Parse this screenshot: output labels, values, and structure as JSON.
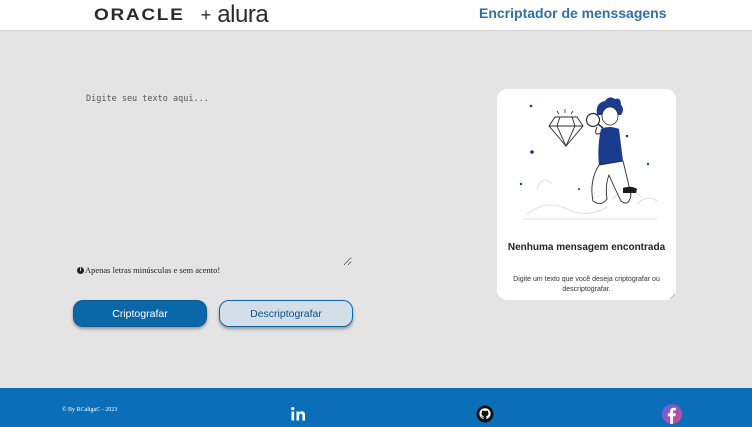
{
  "header": {
    "logo_oracle": "ORACLE",
    "logo_plus": "+",
    "logo_alura": "alura",
    "title": "Encriptador de menssagens"
  },
  "input": {
    "placeholder": "Digite seu texto aqui...",
    "value": ""
  },
  "hint": {
    "icon": "info-icon",
    "text": "Apenas letras minúsculas e sem acento!"
  },
  "buttons": {
    "encrypt_label": "Criptografar",
    "decrypt_label": "Descriptografar"
  },
  "output_card": {
    "title": "Nenhuma mensagem encontrada",
    "subtitle": "Digite um texto que você deseja criptografar ou descriptografar."
  },
  "footer": {
    "copyright": "© By RCaligaC - 2023",
    "icons": [
      "linkedin-icon",
      "github-icon",
      "facebook-icon"
    ]
  },
  "colors": {
    "accent": "#0a68a8",
    "footer": "#0a6fb8",
    "title": "#2e6fa7",
    "background": "#e4e4e4"
  }
}
